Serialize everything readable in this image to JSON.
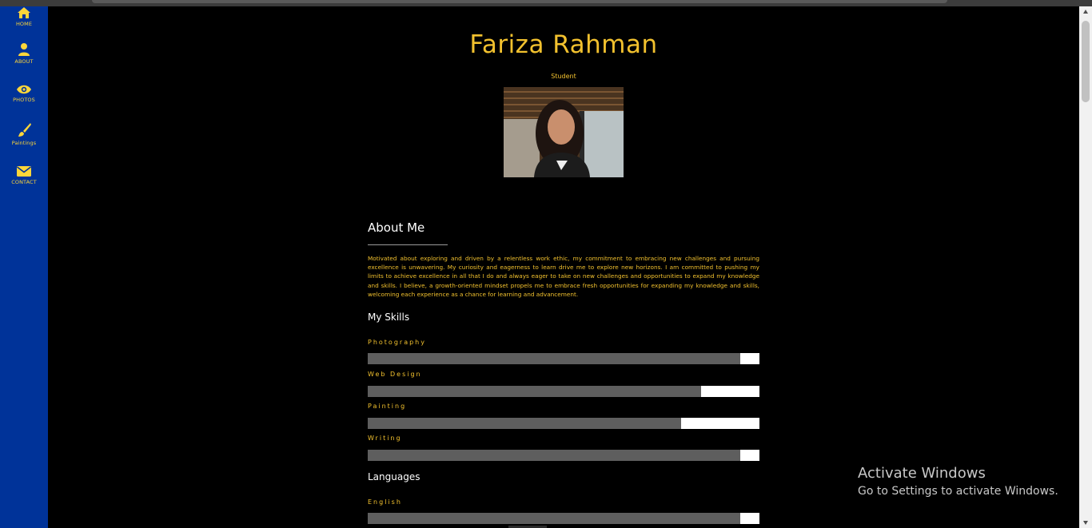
{
  "nav": {
    "items": [
      {
        "label": "HOME",
        "icon": "home-icon"
      },
      {
        "label": "ABOUT",
        "icon": "user-icon"
      },
      {
        "label": "PHOTOS",
        "icon": "eye-icon"
      },
      {
        "label": "Paintings",
        "icon": "brush-icon"
      },
      {
        "label": "CONTACT",
        "icon": "envelope-icon"
      }
    ]
  },
  "profile": {
    "name": "Fariza Rahman",
    "role": "Student"
  },
  "about": {
    "title": "About Me",
    "text": "Motivated about exploring and driven by a relentless work ethic, my commitment to embracing new challenges and pursuing excellence is unwavering. My curiosity and eagerness to learn drive me to explore new horizons. I am committed to pushing my limits to achieve excellence in all that I do and always eager to take on new challenges and opportunities to expand my knowledge and skills. I believe, a growth-oriented mindset propels me to embrace fresh opportunities for expanding my knowledge and skills, welcoming each experience as a chance for learning and advancement."
  },
  "skills": {
    "title": "My Skills",
    "items": [
      {
        "label": "Photography",
        "level": 0.95
      },
      {
        "label": "Web Design",
        "level": 0.85
      },
      {
        "label": "Painting",
        "level": 0.8
      },
      {
        "label": "Writing",
        "level": 0.95
      }
    ]
  },
  "languages": {
    "title": "Languages",
    "items": [
      {
        "label": "English",
        "level": 0.95
      }
    ]
  },
  "watermark": {
    "title": "Activate Windows",
    "subtitle": "Go to Settings to activate Windows."
  },
  "colors": {
    "sidebar": "#003399",
    "accent": "#f2c12e",
    "bar_fill": "#5e5e5e",
    "bar_track": "#ffffff"
  }
}
